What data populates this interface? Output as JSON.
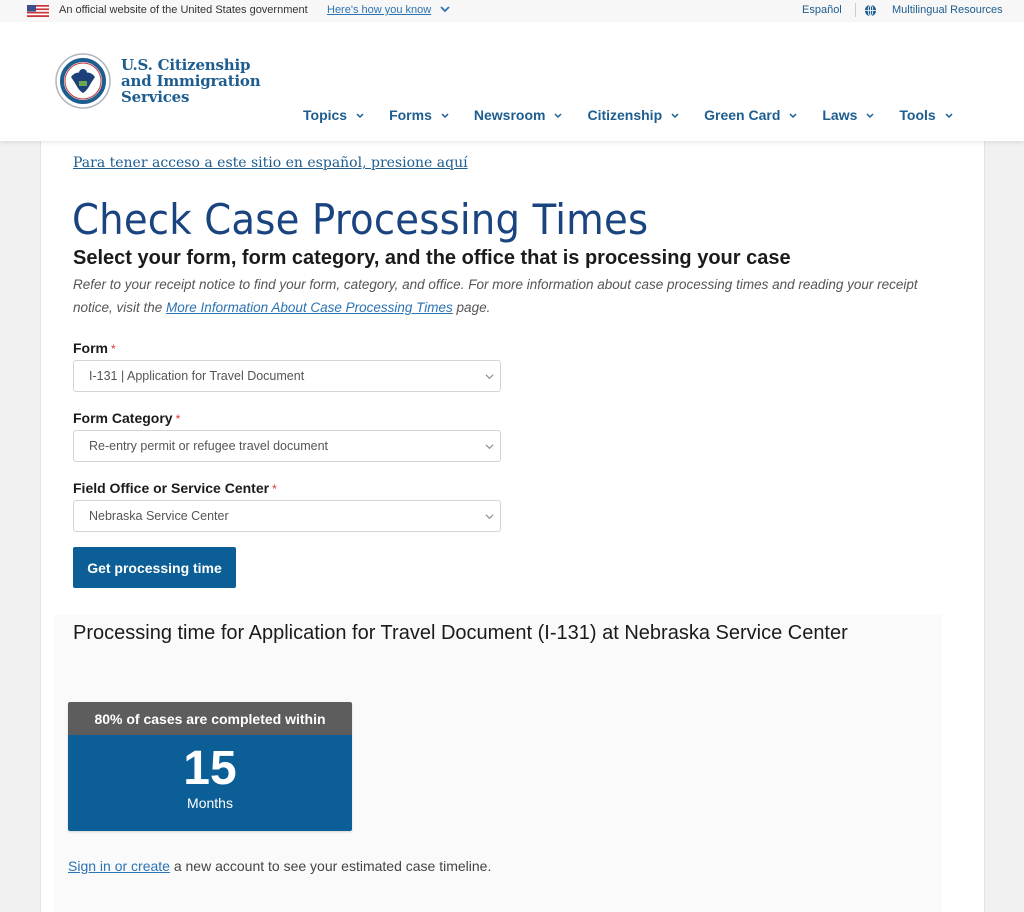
{
  "gov_banner": {
    "official_text": "An official website of the United States government",
    "how_you_know": "Here's how you know",
    "espanol": "Español",
    "multilingual": "Multilingual Resources"
  },
  "header": {
    "agency_line1": "U.S. Citizenship",
    "agency_line2": "and Immigration",
    "agency_line3": "Services",
    "nav": [
      {
        "label": "Topics"
      },
      {
        "label": "Forms"
      },
      {
        "label": "Newsroom"
      },
      {
        "label": "Citizenship"
      },
      {
        "label": "Green Card"
      },
      {
        "label": "Laws"
      },
      {
        "label": "Tools"
      }
    ]
  },
  "main": {
    "spanish_link": "Para tener acceso a este sitio en español, presione aquí",
    "title": "Check Case Processing Times",
    "subtitle": "Select your form, form category, and the office that is processing your case",
    "intro_before": "Refer to your receipt notice to find your form, category, and office. For more information about case processing times and reading your receipt notice, visit the ",
    "intro_link": "More Information About Case Processing Times",
    "intro_after": " page.",
    "form": {
      "form_label": "Form",
      "form_value": "I-131 | Application for Travel Document",
      "category_label": "Form Category",
      "category_value": "Re-entry permit or refugee travel document",
      "office_label": "Field Office or Service Center",
      "office_value": "Nebraska Service Center",
      "required_mark": "*",
      "submit_label": "Get processing time"
    },
    "result": {
      "title": "Processing time for Application for Travel Document (I-131) at Nebraska Service Center",
      "box_header": "80% of cases are completed within",
      "value": "15",
      "unit": "Months",
      "signin_link": "Sign in or create",
      "signin_rest": " a new account to see your estimated case timeline."
    }
  },
  "colors": {
    "primary_blue": "#0b5f96",
    "link_blue": "#2b73b4",
    "title_navy": "#1a4480",
    "required_red": "#d83933",
    "box_header_gray": "#5d5d5d"
  }
}
